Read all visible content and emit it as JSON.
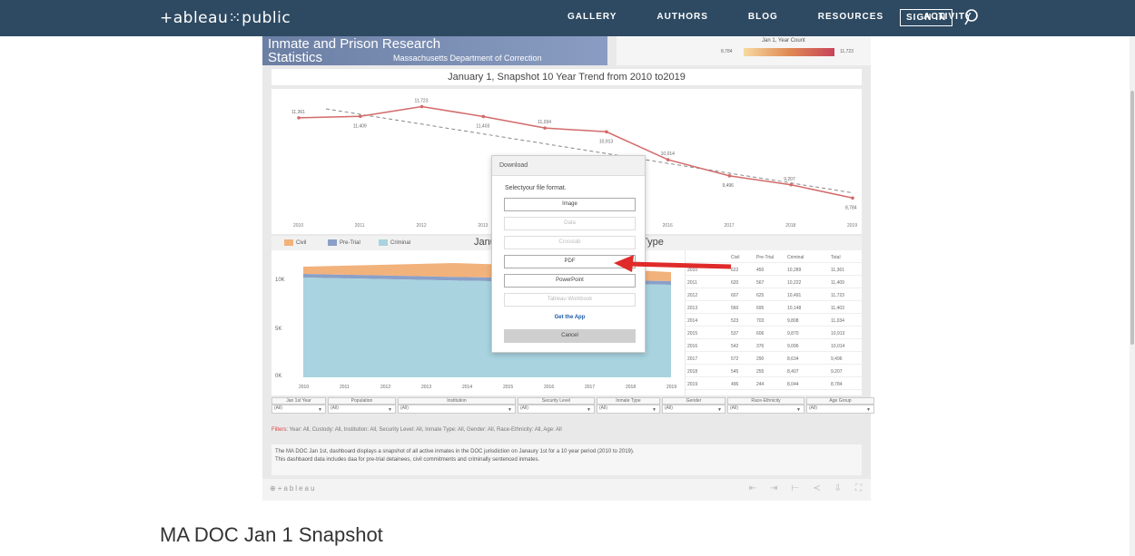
{
  "nav": {
    "logo": "+ableau⁙public",
    "links": [
      "GALLERY",
      "AUTHORS",
      "BLOG",
      "RESOURCES",
      "ACTIVITY"
    ],
    "signin": "SIGN IN"
  },
  "dashboard": {
    "banner_line1": "Inmate and Prison Research",
    "banner_line2": "Statistics",
    "banner_sub": "Massachusetts Department of Correction",
    "legend_title": "Jan 1, Year Count",
    "legend_min": "8,784",
    "legend_max": "11,723",
    "trend_title": "January 1, Snapshot 10 Year Trend from 2010 to2019",
    "area_title_left": "Janu",
    "area_title_right": "Type",
    "legend_civil": "Civil",
    "legend_pretrial": "Pre-Trial",
    "legend_criminal": "Criminal",
    "area_yticks": [
      "10K",
      "5K",
      "0K"
    ],
    "table_headers": [
      "",
      "Civil",
      "Pre-Trial",
      "Criminal",
      "Total"
    ],
    "table_rows": [
      [
        "2010",
        "622",
        "450",
        "10,289",
        "11,361"
      ],
      [
        "2011",
        "620",
        "567",
        "10,222",
        "11,409"
      ],
      [
        "2012",
        "607",
        "625",
        "10,491",
        "11,723"
      ],
      [
        "2013",
        "560",
        "695",
        "10,148",
        "11,403"
      ],
      [
        "2014",
        "523",
        "703",
        "9,808",
        "11,034"
      ],
      [
        "2015",
        "537",
        "606",
        "9,870",
        "10,913"
      ],
      [
        "2016",
        "542",
        "376",
        "9,096",
        "10,014"
      ],
      [
        "2017",
        "572",
        "290",
        "8,634",
        "9,496"
      ],
      [
        "2018",
        "545",
        "255",
        "8,407",
        "9,207"
      ],
      [
        "2019",
        "496",
        "244",
        "8,044",
        "8,784"
      ]
    ],
    "filters": [
      {
        "label": "Jan 1st Year",
        "value": "(All)"
      },
      {
        "label": "Population",
        "value": "(All)"
      },
      {
        "label": "Institution",
        "value": "(All)"
      },
      {
        "label": "Security Level",
        "value": "(All)"
      },
      {
        "label": "Inmate Type",
        "value": "(All)"
      },
      {
        "label": "Gender",
        "value": "(All)"
      },
      {
        "label": "Race-Ethnicity",
        "value": "(All)"
      },
      {
        "label": "Age Group",
        "value": "(All)"
      }
    ],
    "filters_prefix": "Filters:",
    "filters_text": "Year: All, Custody: All, Institution: All, Security Level: All, Inmate Type: All, Gender: All, Race-Ethnicity: All, Age: All",
    "desc_line1": "The MA DOC Jan 1st, dashboard displays a snapshot of all active inmates in the DOC jurisdiction on Janaury 1st for a 10 year period (2010 to 2019).",
    "desc_line2": "This dashbaord data includes daa for pre-trial detainees, civil commitments and criminally sentenced inmates.",
    "footer_logo": "⊕+ableau"
  },
  "dialog": {
    "title": "Download",
    "prompt": "Selectyour file format.",
    "options": [
      "Image",
      "Data",
      "Crosstab",
      "PDF",
      "PowerPoint",
      "Tableau Workbook"
    ],
    "get_app": "Get the App",
    "cancel": "Cancel"
  },
  "page": {
    "title": "MA DOC Jan 1 Snapshot"
  },
  "chart_data": {
    "type": "line",
    "categories": [
      "2010",
      "2011",
      "2012",
      "2013",
      "2014",
      "2015",
      "2016",
      "2017",
      "2018",
      "2019"
    ],
    "values": [
      11361,
      11409,
      11723,
      11403,
      11034,
      10913,
      10014,
      9496,
      9207,
      8784
    ],
    "labels": [
      "11,361",
      "11,409",
      "11,723",
      "11,403",
      "11,034",
      "10,913",
      "10,014",
      "9,496",
      "9,207",
      "8,784"
    ],
    "ylim": [
      8500,
      12000
    ]
  },
  "colors": {
    "nav_bg": "#2e4a62",
    "civil": "#f2b27b",
    "pretrial": "#8aa0c8",
    "criminal": "#a8d3df",
    "line": "#d36a6a",
    "arrow": "#e02a2a"
  }
}
